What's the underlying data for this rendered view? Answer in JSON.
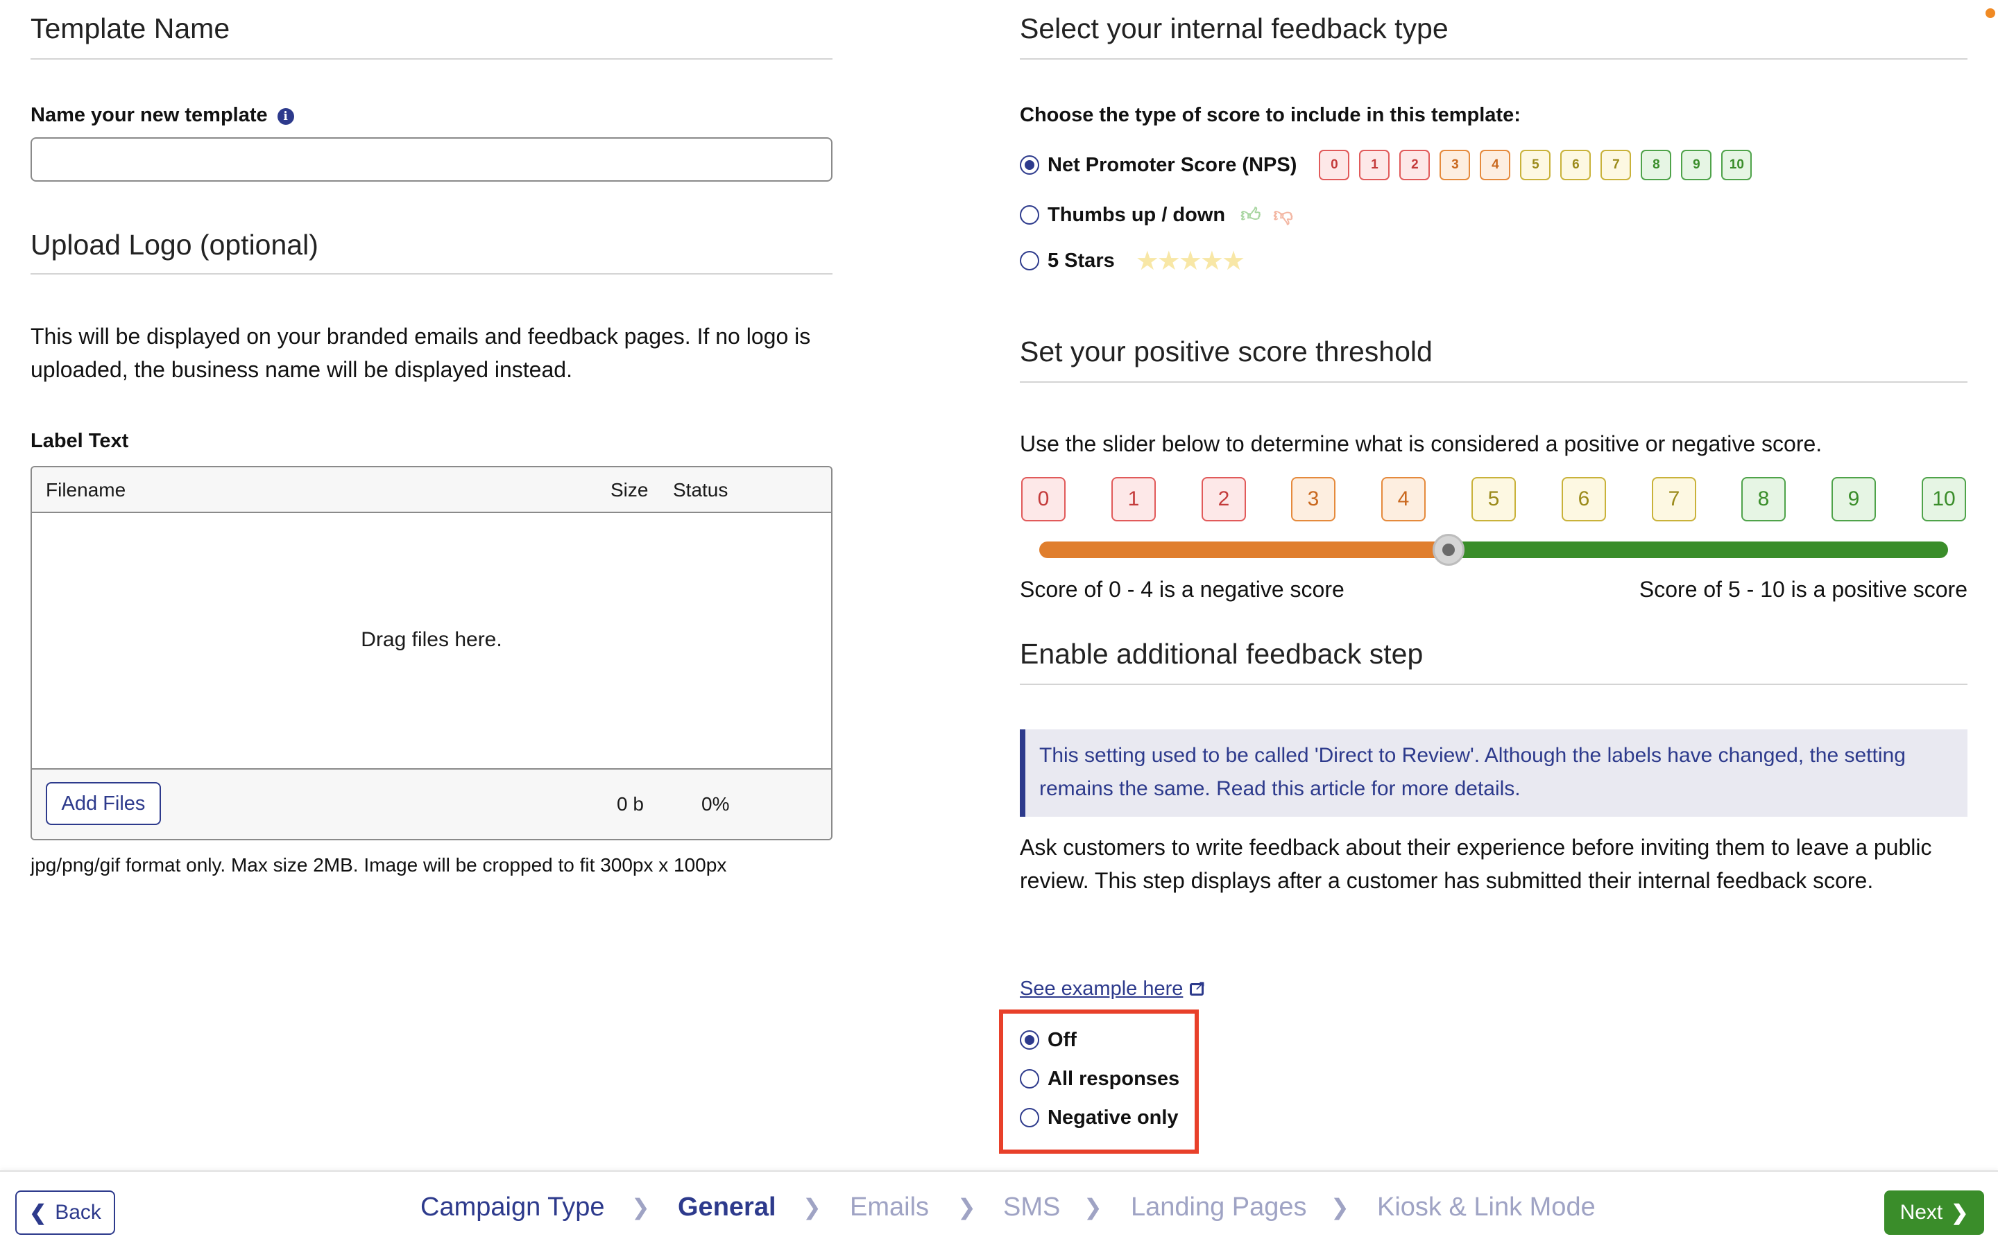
{
  "left": {
    "template_name": {
      "title": "Template Name",
      "field_label": "Name your new template",
      "info_icon": "info-icon",
      "value": "",
      "placeholder": ""
    },
    "upload_logo": {
      "title": "Upload Logo (optional)",
      "description": "This will be displayed on your branded emails and feedback pages. If no logo is uploaded, the business name will be displayed instead.",
      "label_text": "Label Text",
      "uploader": {
        "columns": [
          "Filename",
          "Size",
          "Status"
        ],
        "drag_text": "Drag files here.",
        "add_files_label": "Add Files",
        "total_size": "0 b",
        "total_status": "0%"
      },
      "format_note": "jpg/png/gif format only. Max size 2MB. Image will be cropped to fit 300px x 100px"
    }
  },
  "right": {
    "feedback_type": {
      "title": "Select your internal feedback type",
      "prompt": "Choose the type of score to include in this template:",
      "options": [
        {
          "label": "Net Promoter Score (NPS)",
          "checked": true
        },
        {
          "label": "Thumbs up / down",
          "checked": false
        },
        {
          "label": "5 Stars",
          "checked": false
        }
      ],
      "nps_preview": [
        "0",
        "1",
        "2",
        "3",
        "4",
        "5",
        "6",
        "7",
        "8",
        "9",
        "10"
      ],
      "thumb_icons": [
        "thumbs-up-icon",
        "thumbs-down-icon"
      ],
      "star_count": 5
    },
    "threshold": {
      "title": "Set your positive score threshold",
      "instruction": "Use the slider below to determine what is considered a positive or negative score.",
      "scores": [
        "0",
        "1",
        "2",
        "3",
        "4",
        "5",
        "6",
        "7",
        "8",
        "9",
        "10"
      ],
      "threshold_value": 4.5,
      "negative_text": "Score of 0 - 4 is a negative score",
      "positive_text": "Score of 5 - 10 is a positive score"
    },
    "additional_step": {
      "title": "Enable additional feedback step",
      "notice": "This setting used to be called 'Direct to Review'. Although the labels have changed, the setting remains the same. Read this article for more details.",
      "description": "Ask customers to write feedback about their experience before inviting them to leave a public review. This step displays after a customer has submitted their internal feedback score.",
      "example_link": "See example here",
      "external_icon": "external-link-icon",
      "options": [
        {
          "label": "Off",
          "checked": true
        },
        {
          "label": "All responses",
          "checked": false
        },
        {
          "label": "Negative only",
          "checked": false
        }
      ]
    }
  },
  "score_colors": {
    "red": {
      "border": "#e15a5a",
      "bg": "#fde8e8",
      "text": "#c43b3b"
    },
    "orange": {
      "border": "#e58a3c",
      "bg": "#fdeee0",
      "text": "#c9681e"
    },
    "yellow": {
      "border": "#c9b23a",
      "bg": "#fdf8e2",
      "text": "#9b8a1a"
    },
    "green": {
      "border": "#4fa34a",
      "bg": "#e6f5e4",
      "text": "#3a8d2a"
    }
  },
  "slider_colors": {
    "negative": "#e07e2d",
    "positive": "#3a8d2a"
  },
  "footer": {
    "back_label": "Back",
    "next_label": "Next",
    "steps": [
      {
        "label": "Campaign Type",
        "state": "done"
      },
      {
        "label": "General",
        "state": "current"
      },
      {
        "label": "Emails",
        "state": "future"
      },
      {
        "label": "SMS",
        "state": "future"
      },
      {
        "label": "Landing Pages",
        "state": "future"
      },
      {
        "label": "Kiosk & Link Mode",
        "state": "future"
      }
    ]
  }
}
